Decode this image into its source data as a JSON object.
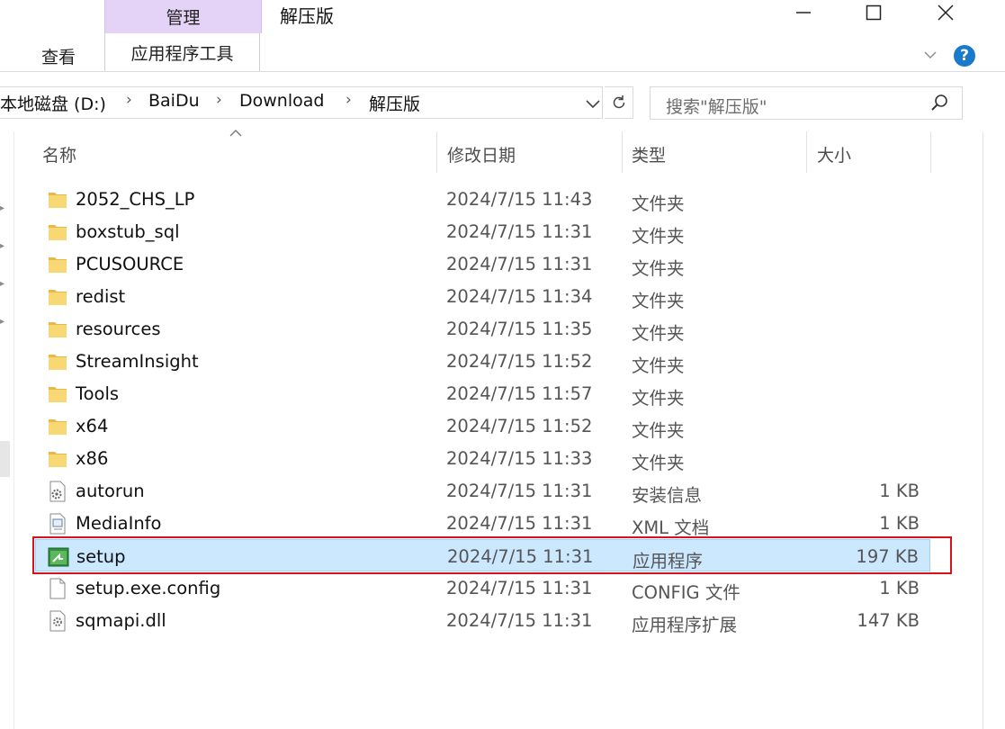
{
  "ribbon": {
    "contextual_group": "管理",
    "window_title": "解压版",
    "tab_view": "查看",
    "tab_app_tools": "应用程序工具",
    "help_label": "?"
  },
  "address": {
    "crumbs": [
      "本地磁盘 (D:)",
      "BaiDu",
      "Download",
      "解压版"
    ],
    "separator": "›"
  },
  "search": {
    "placeholder": "搜索\"解压版\""
  },
  "columns": {
    "name": "名称",
    "date": "修改日期",
    "type": "类型",
    "size": "大小"
  },
  "files": [
    {
      "name": "2052_CHS_LP",
      "date": "2024/7/15 11:43",
      "type": "文件夹",
      "size": "",
      "icon": "folder-icon"
    },
    {
      "name": "boxstub_sql",
      "date": "2024/7/15 11:31",
      "type": "文件夹",
      "size": "",
      "icon": "folder-icon"
    },
    {
      "name": "PCUSOURCE",
      "date": "2024/7/15 11:31",
      "type": "文件夹",
      "size": "",
      "icon": "folder-icon"
    },
    {
      "name": "redist",
      "date": "2024/7/15 11:34",
      "type": "文件夹",
      "size": "",
      "icon": "folder-icon"
    },
    {
      "name": "resources",
      "date": "2024/7/15 11:35",
      "type": "文件夹",
      "size": "",
      "icon": "folder-icon"
    },
    {
      "name": "StreamInsight",
      "date": "2024/7/15 11:52",
      "type": "文件夹",
      "size": "",
      "icon": "folder-icon"
    },
    {
      "name": "Tools",
      "date": "2024/7/15 11:57",
      "type": "文件夹",
      "size": "",
      "icon": "folder-icon"
    },
    {
      "name": "x64",
      "date": "2024/7/15 11:52",
      "type": "文件夹",
      "size": "",
      "icon": "folder-icon"
    },
    {
      "name": "x86",
      "date": "2024/7/15 11:33",
      "type": "文件夹",
      "size": "",
      "icon": "folder-icon"
    },
    {
      "name": "autorun",
      "date": "2024/7/15 11:31",
      "type": "安装信息",
      "size": "1 KB",
      "icon": "setup-info-icon"
    },
    {
      "name": "MediaInfo",
      "date": "2024/7/15 11:31",
      "type": "XML 文档",
      "size": "1 KB",
      "icon": "xml-document-icon"
    },
    {
      "name": "setup",
      "date": "2024/7/15 11:31",
      "type": "应用程序",
      "size": "197 KB",
      "icon": "application-icon",
      "selected": true
    },
    {
      "name": "setup.exe.config",
      "date": "2024/7/15 11:31",
      "type": "CONFIG 文件",
      "size": "1 KB",
      "icon": "blank-file-icon"
    },
    {
      "name": "sqmapi.dll",
      "date": "2024/7/15 11:31",
      "type": "应用程序扩展",
      "size": "147 KB",
      "icon": "dll-file-icon"
    }
  ],
  "colors": {
    "selection": "#cce8ff",
    "highlight_border": "#d6121c",
    "contextual_tab": "#e4d3f6",
    "folder": "#f8d775"
  }
}
